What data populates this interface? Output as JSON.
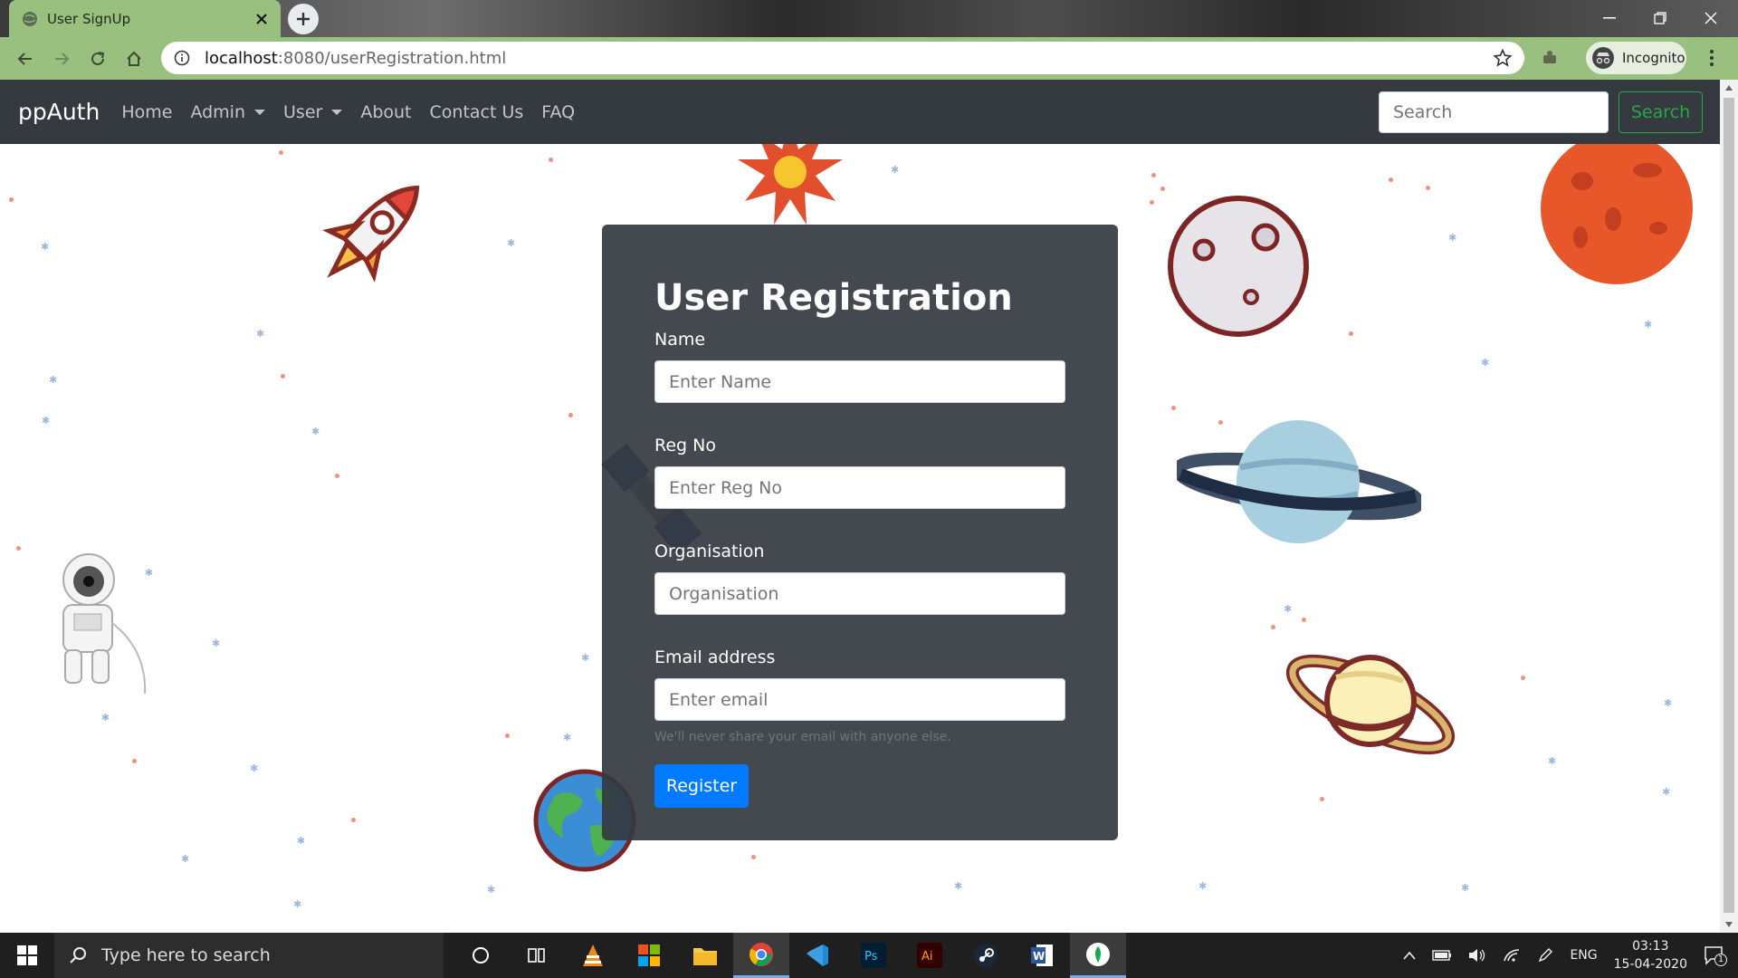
{
  "browser": {
    "tab_title": "User SignUp",
    "url_prefix": "localhost",
    "url_rest": ":8080/userRegistration.html",
    "profile_label": "Incognito"
  },
  "navbar": {
    "brand": "ppAuth",
    "links": [
      "Home",
      "Admin",
      "User",
      "About",
      "Contact Us",
      "FAQ"
    ],
    "search_placeholder": "Search",
    "search_button": "Search"
  },
  "form": {
    "title": "User Registration",
    "name_label": "Name",
    "name_placeholder": "Enter Name",
    "regno_label": "Reg No",
    "regno_placeholder": "Enter Reg No",
    "org_label": "Organisation",
    "org_placeholder": "Organisation",
    "email_label": "Email address",
    "email_placeholder": "Enter email",
    "email_help": "We'll never share your email with anyone else.",
    "submit_label": "Register"
  },
  "taskbar": {
    "search_text": "Type here to search",
    "language": "ENG",
    "time": "03:13",
    "date": "15-04-2020",
    "notification_count": "1"
  },
  "colors": {
    "chrome_green": "#99c07f",
    "navbar": "#343a40",
    "primary": "#007bff",
    "success": "#28a745"
  }
}
